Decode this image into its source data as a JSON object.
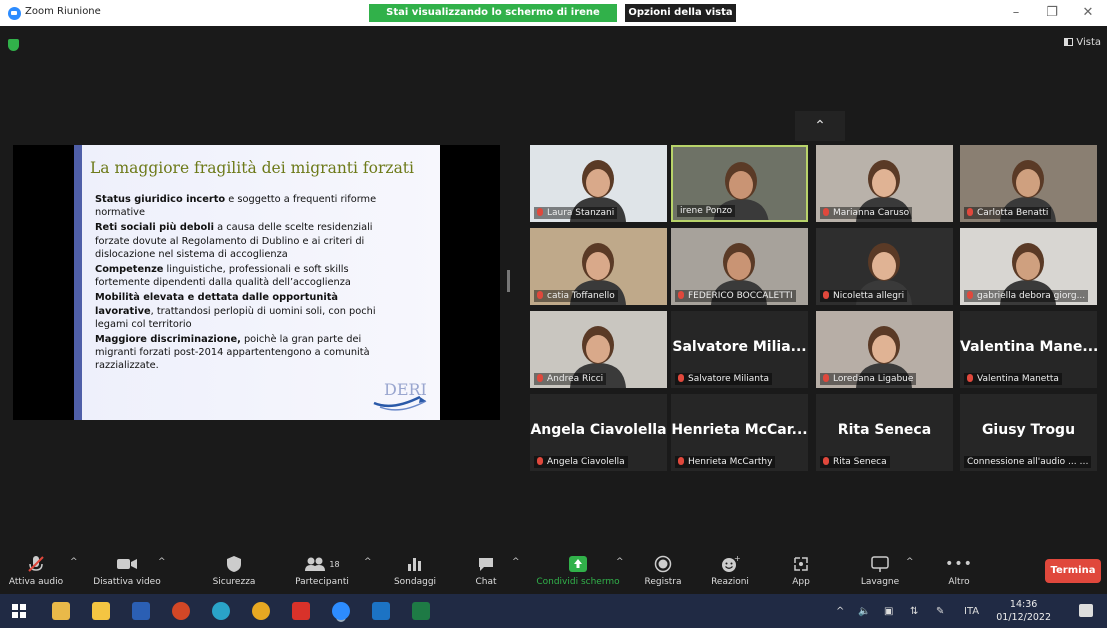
{
  "window": {
    "title": "Zoom Riunione",
    "share_banner": "Stai visualizzando lo schermo di irene Ponzo",
    "view_options": "Opzioni della vista ⌄",
    "view_label": "Vista"
  },
  "slide": {
    "title": "La maggiore fragilità dei migranti forzati",
    "bullets": [
      {
        "bold": "Status giuridico incerto",
        "rest": " e soggetto a frequenti riforme normative"
      },
      {
        "bold": "Reti sociali più deboli",
        "rest": " a causa delle scelte residenziali forzate dovute al Regolamento di Dublino e ai criteri di dislocazione nel sistema di accoglienza"
      },
      {
        "bold": "Competenze",
        "rest": " linguistiche, professionali e soft skills fortemente dipendenti dalla qualità dell’accoglienza"
      },
      {
        "bold": "Mobilità elevata e dettata dalle opportunità lavorative",
        "rest": ", trattandosi perlopiù di uomini soli, con pochi legami col territorio"
      },
      {
        "bold": "Maggiore discriminazione,",
        "rest": " poichè  la gran parte dei migranti forzati post-2014 appartentengono a comunità razzializzate."
      }
    ],
    "logo_text": "DERI"
  },
  "participants": [
    {
      "name": "Laura Stanzani",
      "muted": true,
      "video": true
    },
    {
      "name": "irene Ponzo",
      "muted": false,
      "video": true,
      "active": true
    },
    {
      "name": "Marianna Caruso",
      "muted": true,
      "video": true
    },
    {
      "name": "Carlotta Benatti",
      "muted": true,
      "video": true
    },
    {
      "name": "catia Toffanello",
      "muted": true,
      "video": true
    },
    {
      "name": "FEDERICO BOCCALETTI",
      "muted": true,
      "video": true
    },
    {
      "name": "Nicoletta allegri",
      "muted": true,
      "video": true
    },
    {
      "name": "gabriella debora giorg...",
      "muted": true,
      "video": true
    },
    {
      "name": "Andrea Ricci",
      "muted": true,
      "video": true
    },
    {
      "name": "Salvatore Milianta",
      "display": "Salvatore Milia...",
      "muted": true,
      "video": false
    },
    {
      "name": "Loredana Ligabue",
      "muted": true,
      "video": true
    },
    {
      "name": "Valentina Manetta",
      "display": "Valentina  Mane...",
      "muted": true,
      "video": false
    },
    {
      "name": "Angela Ciavolella",
      "display": "Angela Ciavolella",
      "muted": true,
      "video": false
    },
    {
      "name": "Henrieta McCarthy",
      "display": "Henrieta  McCar...",
      "muted": true,
      "video": false
    },
    {
      "name": "Rita Seneca",
      "display": "Rita Seneca",
      "muted": true,
      "video": false
    },
    {
      "name": "Connessione all'audio ... …",
      "display": "Giusy Trogu",
      "muted": false,
      "video": false
    }
  ],
  "toolbar": {
    "audio": "Attiva audio",
    "video": "Disattiva video",
    "security": "Sicurezza",
    "participants": "Partecipanti",
    "participants_count": "18",
    "polls": "Sondaggi",
    "chat": "Chat",
    "share": "Condividi schermo",
    "record": "Registra",
    "reactions": "Reazioni",
    "apps": "App",
    "whiteboards": "Lavagne",
    "more": "Altro",
    "end": "Termina"
  },
  "taskbar": {
    "language": "ITA",
    "time": "14:36",
    "date": "01/12/2022"
  },
  "colors": {
    "share_banner": "#31b14a",
    "end_button": "#e0483c",
    "active_speaker": "#b8d36a",
    "slide_title": "#6d7a19",
    "slide_stripe": "#4f5fa8"
  }
}
